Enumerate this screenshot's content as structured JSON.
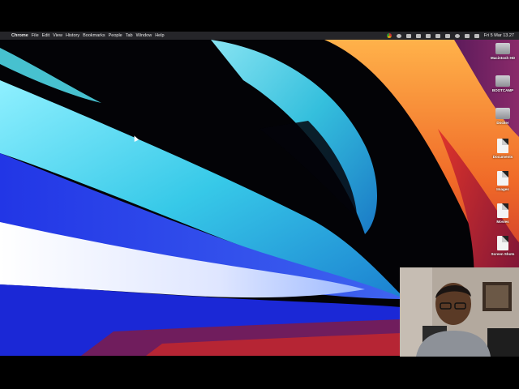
{
  "menubar": {
    "apple": "",
    "items": [
      "Chrome",
      "File",
      "Edit",
      "View",
      "History",
      "Bookmarks",
      "People",
      "Tab",
      "Window",
      "Help"
    ],
    "clock": "Fri 5 Mar 13.27"
  },
  "desktop": {
    "items": [
      {
        "label": "Macintosh HD",
        "icon": "hard-drive-icon"
      },
      {
        "label": "BOOTCAMP",
        "icon": "hard-drive-icon"
      },
      {
        "label": "Docker",
        "icon": "hard-drive-icon"
      },
      {
        "label": "Documents",
        "icon": "document-icon"
      },
      {
        "label": "Images",
        "icon": "image-file-icon"
      },
      {
        "label": "Movies",
        "icon": "movie-file-icon"
      },
      {
        "label": "Screen Shots",
        "icon": "screenshot-file-icon"
      }
    ]
  },
  "colors": {
    "menubar": "#28282c",
    "wave_cyan": "#4fd6e6",
    "wave_blue": "#1a2fd8",
    "wave_orange": "#f08a2a",
    "wave_red": "#c8282a"
  }
}
